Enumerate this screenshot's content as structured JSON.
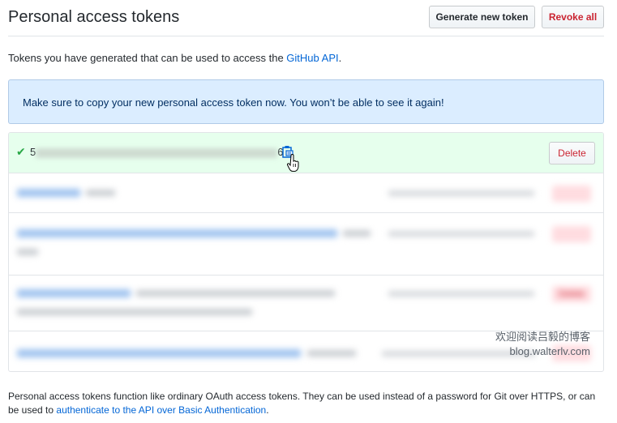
{
  "header": {
    "title": "Personal access tokens",
    "generate_label": "Generate new token",
    "revoke_all_label": "Revoke all"
  },
  "intro": {
    "text": "Tokens you have generated that can be used to access the ",
    "link": "GitHub API",
    "suffix": "."
  },
  "flash": {
    "message": "Make sure to copy your new personal access token now. You won’t be able to see it again!"
  },
  "new_token": {
    "prefix": "5",
    "suffix": "6",
    "delete_label": "Delete"
  },
  "tokens": [
    {
      "name": "",
      "scopes": "",
      "meta": "",
      "delete_label": ""
    },
    {
      "name": "",
      "scopes": "",
      "meta": "",
      "delete_label": ""
    },
    {
      "name": "",
      "scopes": "",
      "meta": "",
      "delete_label": "Delete"
    },
    {
      "name": "",
      "scopes": "",
      "meta": "",
      "delete_label": ""
    }
  ],
  "watermark": {
    "line1": "欢迎阅读吕毅的博客",
    "line2": "blog.walterlv.com"
  },
  "footer": {
    "text": "Personal access tokens function like ordinary OAuth access tokens. They can be used instead of a password for Git over HTTPS, or can be used to ",
    "link": "authenticate to the API over Basic Authentication",
    "suffix": "."
  },
  "colors": {
    "link": "#0366d6",
    "danger": "#cb2431",
    "success": "#28a745",
    "flash_bg": "#dbedff",
    "new_token_bg": "#e6ffed"
  }
}
